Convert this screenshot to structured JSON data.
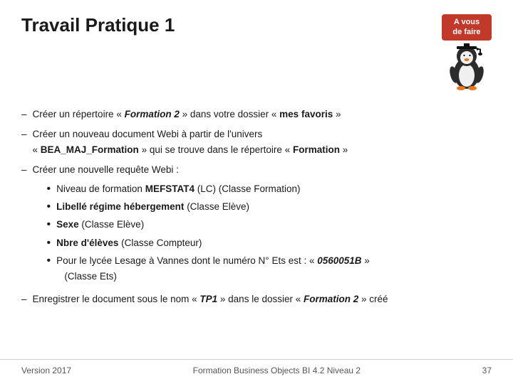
{
  "header": {
    "title": "Travail Pratique 1",
    "badge": {
      "line1": "A vous",
      "line2": "de faire"
    }
  },
  "content": {
    "items": [
      {
        "id": "item1",
        "text_before": "Créer un répertoire « ",
        "text_bold_italic": "Formation 2",
        "text_after": " » dans votre dossier « ",
        "text_bold": "mes favoris",
        "text_end": " »"
      },
      {
        "id": "item2",
        "text_before": "Créer un nouveau document Webi à partir de l'univers « ",
        "text_bold": "BEA_MAJ_Formation",
        "text_after": " » qui se trouve dans le répertoire « ",
        "text_bold2": "Formation",
        "text_end": " »"
      },
      {
        "id": "item3",
        "intro": "Créer une nouvelle requête Webi :",
        "bullets": [
          {
            "text_before": "Niveau de formation ",
            "text_bold": "MEFSTAT4",
            "text_after": " (LC) (Classe Formation)"
          },
          {
            "text_before": "",
            "text_bold": "Libellé régime hébergement",
            "text_after": "  (Classe Elève)"
          },
          {
            "text_before": "",
            "text_bold": "Sexe",
            "text_after": " (Classe Elève)"
          },
          {
            "text_before": "",
            "text_bold": "Nbre d'élèves",
            "text_after": " (Classe Compteur)"
          },
          {
            "text_before": "Pour le lycée Lesage à Vannes dont le numéro N° Ets est : « ",
            "text_bold_italic": "0560051B",
            "text_after": " » (Classe Ets)"
          }
        ]
      },
      {
        "id": "item4",
        "text_before": "Enregistrer le document sous le nom « ",
        "text_bold_italic": "TP1",
        "text_middle": " » dans le dossier « ",
        "text_bold_italic2": "Formation 2",
        "text_after": " » créé"
      }
    ]
  },
  "footer": {
    "left": "Version 2017",
    "center": "Formation Business Objects BI 4.2 Niveau 2",
    "right": "37"
  }
}
